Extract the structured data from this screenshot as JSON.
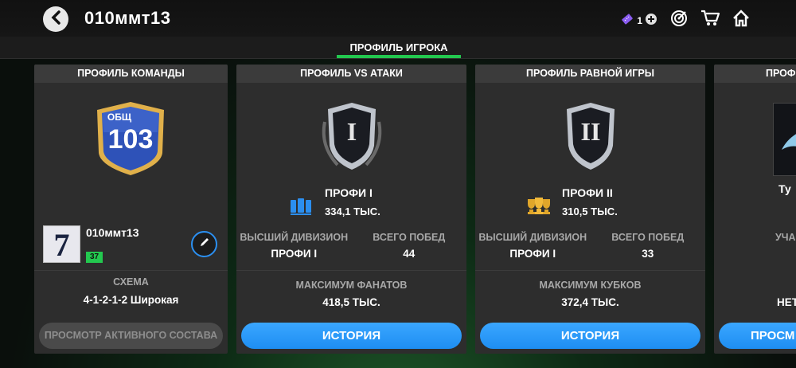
{
  "header": {
    "title": "010ммт13",
    "ticket_count": "1",
    "icons": [
      "chevron-left-icon",
      "ticket-icon",
      "plus-icon",
      "target-icon",
      "cart-icon",
      "home-icon"
    ]
  },
  "tabs": {
    "active": "ПРОФИЛЬ ИГРОКА"
  },
  "team_card": {
    "heading": "ПРОФИЛЬ КОМАНДЫ",
    "badge_label": "ОБЩ",
    "badge_value": "103",
    "kit_number": "7",
    "club_name": "010ммт13",
    "level": "37",
    "formation_label": "СХЕМА",
    "formation_value": "4-1-2-1-2 Широкая",
    "view_squad_label": "ПРОСМОТР АКТИВНОГО СОСТАВА"
  },
  "vs_attack_card": {
    "heading": "ПРОФИЛЬ VS АТАКИ",
    "rank_numeral": "I",
    "rank_name": "ПРОФИ I",
    "rank_points": "334,1 ТЫС.",
    "best_division_label": "ВЫСШИЙ ДИВИЗИОН",
    "best_division_value": "ПРОФИ I",
    "total_wins_label": "ВСЕГО ПОБЕД",
    "total_wins_value": "44",
    "max_label": "МАКСИМУМ ФАНАТОВ",
    "max_value": "418,5 ТЫС.",
    "history_label": "ИСТОРИЯ"
  },
  "h2h_card": {
    "heading": "ПРОФИЛЬ РАВНОЙ ИГРЫ",
    "rank_numeral": "II",
    "rank_name": "ПРОФИ II",
    "rank_points": "310,5 ТЫС.",
    "best_division_label": "ВЫСШИЙ ДИВИЗИОН",
    "best_division_value": "ПРОФИ I",
    "total_wins_label": "ВСЕГО ПОБЕД",
    "total_wins_value": "33",
    "max_label": "МАКСИМУМ КУБКОВ",
    "max_value": "372,4 ТЫС.",
    "history_label": "ИСТОРИЯ"
  },
  "partial_card": {
    "heading_partial": "ПРОФ",
    "name_partial": "Ту",
    "label_partial": "УЧА",
    "value_partial": "НЕТ",
    "button_partial": "ПРОСМ"
  },
  "colors": {
    "accent_green": "#23c84f",
    "button_blue": "#1e8ef2",
    "card_bg": "#2d2d2d",
    "badge_blue": "#2e52b8",
    "badge_gold": "#e0b04a"
  }
}
